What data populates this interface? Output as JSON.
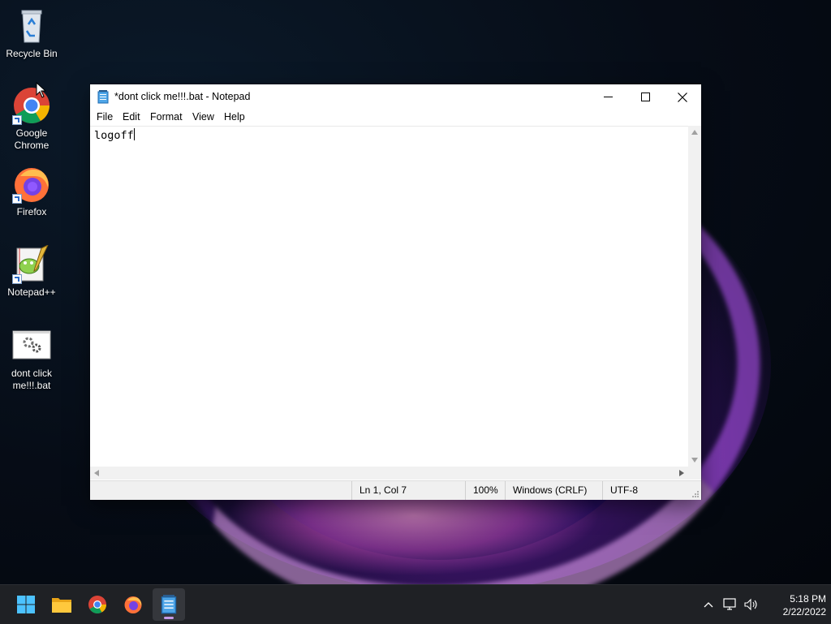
{
  "desktop": {
    "icons": [
      {
        "label": "Recycle Bin"
      },
      {
        "label": "Google Chrome"
      },
      {
        "label": "Firefox"
      },
      {
        "label": "Notepad++"
      },
      {
        "label": "dont click me!!!.bat"
      }
    ]
  },
  "window": {
    "title": "*dont click me!!!.bat - Notepad",
    "menu": [
      "File",
      "Edit",
      "Format",
      "View",
      "Help"
    ],
    "content": "logoff",
    "status": {
      "position": "Ln 1, Col 7",
      "zoom": "100%",
      "line_ending": "Windows (CRLF)",
      "encoding": "UTF-8"
    }
  },
  "taskbar": {
    "apps": [
      "start-icon",
      "file-explorer-icon",
      "chrome-icon",
      "firefox-icon",
      "notepad-icon"
    ],
    "active_app": "notepad-icon",
    "tray": [
      "chevron-up-icon",
      "network-icon",
      "volume-icon"
    ],
    "clock": {
      "time": "5:18 PM",
      "date": "2/22/2022"
    }
  },
  "colors": {
    "taskbar_bg": "#1f2125",
    "window_bg": "#ffffff",
    "accent_indicator": "#c59be8",
    "wallpaper_glow": "#8c28dc"
  }
}
